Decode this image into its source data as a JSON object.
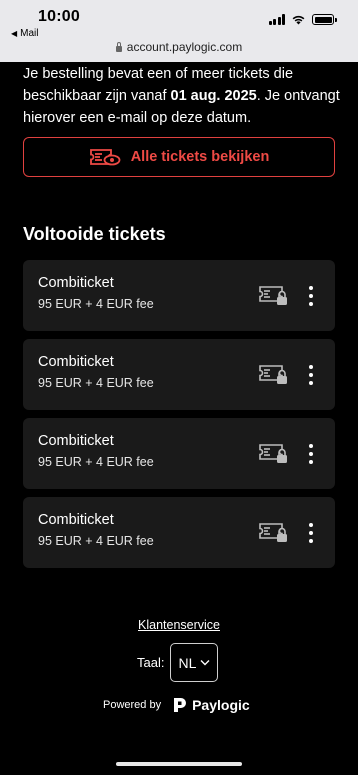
{
  "status_bar": {
    "time": "10:00",
    "back_app": "Mail"
  },
  "browser": {
    "url": "account.paylogic.com"
  },
  "intro": {
    "text_before": "Je bestelling bevat een of meer tickets die beschikbaar zijn vanaf ",
    "date": "01 aug. 2025",
    "text_after": ". Je ontvangt hierover een e-mail op deze datum."
  },
  "all_tickets_button": {
    "label": "Alle tickets bekijken",
    "color": "#ee4a45"
  },
  "completed_section": {
    "title": "Voltooide tickets",
    "tickets": [
      {
        "name": "Combiticket",
        "price": "95 EUR + 4 EUR fee",
        "icon": "ticket-lock-icon"
      },
      {
        "name": "Combiticket",
        "price": "95 EUR + 4 EUR fee",
        "icon": "ticket-lock-icon"
      },
      {
        "name": "Combiticket",
        "price": "95 EUR + 4 EUR fee",
        "icon": "ticket-lock-icon"
      },
      {
        "name": "Combiticket",
        "price": "95 EUR + 4 EUR fee",
        "icon": "ticket-lock-icon"
      }
    ]
  },
  "footer": {
    "customer_service": "Klantenservice",
    "language_label": "Taal:",
    "language_value": "NL",
    "powered_by": "Powered by",
    "brand": "Paylogic"
  }
}
